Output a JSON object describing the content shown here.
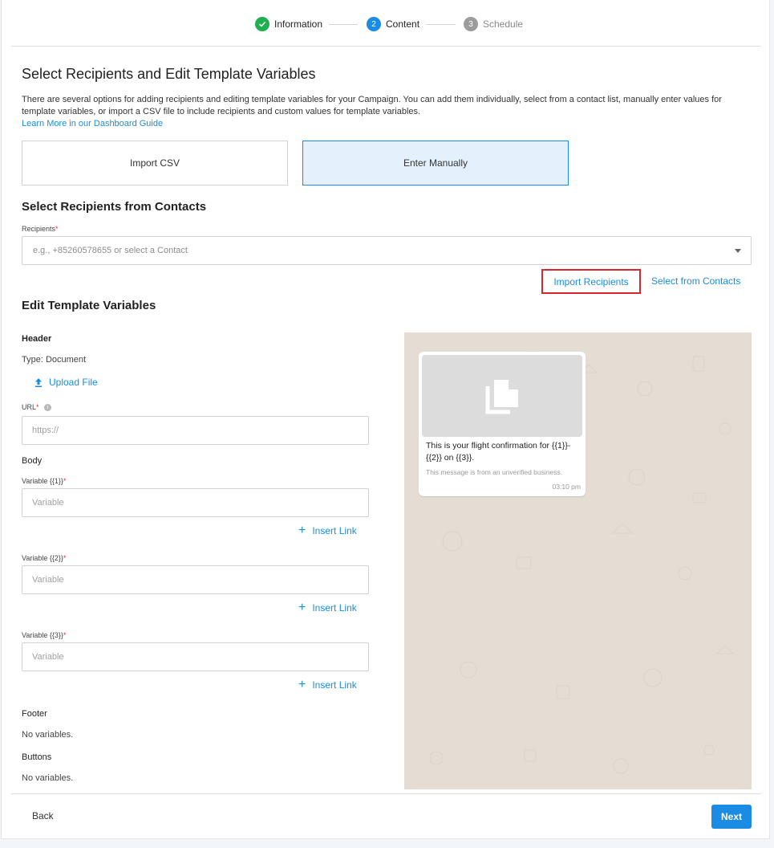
{
  "stepper": {
    "steps": [
      {
        "number": "",
        "label": "Information",
        "status": "complete"
      },
      {
        "number": "2",
        "label": "Content",
        "status": "active"
      },
      {
        "number": "3",
        "label": "Schedule",
        "status": "pending"
      }
    ]
  },
  "intro": {
    "title": "Select Recipients and Edit Template Variables",
    "description": "There are several options for adding recipients and editing template variables for your Campaign. You can add them individually, select from a contact list, manually enter values for template variables, or import a CSV file to include recipients and custom values for template variables.",
    "learn_more": "Learn More in our Dashboard Guide"
  },
  "options": {
    "import_csv": "Import CSV",
    "enter_manually": "Enter Manually"
  },
  "recipients": {
    "section_title": "Select Recipients from Contacts",
    "label": "Recipients",
    "required_mark": "*",
    "placeholder": "e.g., +85260578655 or select a Contact",
    "import_recipients": "Import Recipients",
    "select_from_contacts": "Select from Contacts"
  },
  "template": {
    "section_title": "Edit Template Variables",
    "header_label": "Header",
    "header_type": "Type: Document",
    "upload_file": "Upload File",
    "url_label": "URL",
    "url_placeholder": "https://",
    "body_label": "Body",
    "variables": [
      {
        "label": "Variable {{1}}",
        "placeholder": "Variable",
        "insert_link": "Insert Link"
      },
      {
        "label": "Variable {{2}}",
        "placeholder": "Variable",
        "insert_link": "Insert Link"
      },
      {
        "label": "Variable {{3}}",
        "placeholder": "Variable",
        "insert_link": "Insert Link"
      }
    ],
    "footer_label": "Footer",
    "footer_value": "No variables.",
    "buttons_label": "Buttons",
    "buttons_value": "No variables."
  },
  "preview": {
    "message": "This is your flight confirmation for {{1}}-{{2}} on {{3}}.",
    "note": "This message is from an unverified business.",
    "time": "03:10 pm"
  },
  "footer": {
    "back": "Back",
    "next": "Next"
  },
  "colors": {
    "accent": "#1a8ce3",
    "success": "#1fae50",
    "highlight_border": "#d9262c",
    "preview_bg": "#e5ddd4"
  }
}
